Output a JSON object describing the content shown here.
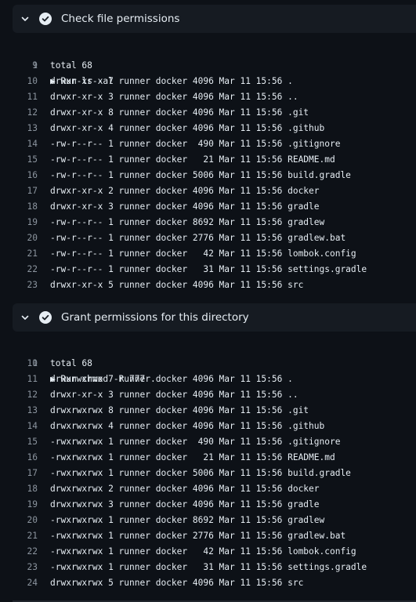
{
  "steps": [
    {
      "title": "Check file permissions",
      "command": "Run ls -al",
      "lines": [
        {
          "n": "1",
          "text": "Run ls -al"
        },
        {
          "n": "9",
          "text": "total 68"
        },
        {
          "n": "10",
          "text": "drwxr-xr-x 7 runner docker 4096 Mar 11 15:56 ."
        },
        {
          "n": "11",
          "text": "drwxr-xr-x 3 runner docker 4096 Mar 11 15:56 .."
        },
        {
          "n": "12",
          "text": "drwxr-xr-x 8 runner docker 4096 Mar 11 15:56 .git"
        },
        {
          "n": "13",
          "text": "drwxr-xr-x 4 runner docker 4096 Mar 11 15:56 .github"
        },
        {
          "n": "14",
          "text": "-rw-r--r-- 1 runner docker  490 Mar 11 15:56 .gitignore"
        },
        {
          "n": "15",
          "text": "-rw-r--r-- 1 runner docker   21 Mar 11 15:56 README.md"
        },
        {
          "n": "16",
          "text": "-rw-r--r-- 1 runner docker 5006 Mar 11 15:56 build.gradle"
        },
        {
          "n": "17",
          "text": "drwxr-xr-x 2 runner docker 4096 Mar 11 15:56 docker"
        },
        {
          "n": "18",
          "text": "drwxr-xr-x 3 runner docker 4096 Mar 11 15:56 gradle"
        },
        {
          "n": "19",
          "text": "-rw-r--r-- 1 runner docker 8692 Mar 11 15:56 gradlew"
        },
        {
          "n": "20",
          "text": "-rw-r--r-- 1 runner docker 2776 Mar 11 15:56 gradlew.bat"
        },
        {
          "n": "21",
          "text": "-rw-r--r-- 1 runner docker   42 Mar 11 15:56 lombok.config"
        },
        {
          "n": "22",
          "text": "-rw-r--r-- 1 runner docker   31 Mar 11 15:56 settings.gradle"
        },
        {
          "n": "23",
          "text": "drwxr-xr-x 5 runner docker 4096 Mar 11 15:56 src"
        }
      ]
    },
    {
      "title": "Grant permissions for this directory",
      "command": "Run chmod -R 777 .",
      "lines": [
        {
          "n": "1",
          "text": "Run chmod -R 777 ."
        },
        {
          "n": "10",
          "text": "total 68"
        },
        {
          "n": "11",
          "text": "drwxrwxrwx 7 runner docker 4096 Mar 11 15:56 ."
        },
        {
          "n": "12",
          "text": "drwxr-xr-x 3 runner docker 4096 Mar 11 15:56 .."
        },
        {
          "n": "13",
          "text": "drwxrwxrwx 8 runner docker 4096 Mar 11 15:56 .git"
        },
        {
          "n": "14",
          "text": "drwxrwxrwx 4 runner docker 4096 Mar 11 15:56 .github"
        },
        {
          "n": "15",
          "text": "-rwxrwxrwx 1 runner docker  490 Mar 11 15:56 .gitignore"
        },
        {
          "n": "16",
          "text": "-rwxrwxrwx 1 runner docker   21 Mar 11 15:56 README.md"
        },
        {
          "n": "17",
          "text": "-rwxrwxrwx 1 runner docker 5006 Mar 11 15:56 build.gradle"
        },
        {
          "n": "18",
          "text": "drwxrwxrwx 2 runner docker 4096 Mar 11 15:56 docker"
        },
        {
          "n": "19",
          "text": "drwxrwxrwx 3 runner docker 4096 Mar 11 15:56 gradle"
        },
        {
          "n": "20",
          "text": "-rwxrwxrwx 1 runner docker 8692 Mar 11 15:56 gradlew"
        },
        {
          "n": "21",
          "text": "-rwxrwxrwx 1 runner docker 2776 Mar 11 15:56 gradlew.bat"
        },
        {
          "n": "22",
          "text": "-rwxrwxrwx 1 runner docker   42 Mar 11 15:56 lombok.config"
        },
        {
          "n": "23",
          "text": "-rwxrwxrwx 1 runner docker   31 Mar 11 15:56 settings.gradle"
        },
        {
          "n": "24",
          "text": "drwxrwxrwx 5 runner docker 4096 Mar 11 15:56 src"
        }
      ]
    }
  ],
  "icons": {
    "expand": "chevron-down-icon",
    "status": "check-circle-icon",
    "toggle": "triangle-right-icon"
  },
  "colors": {
    "background": "#0d1117",
    "header_background": "#161b22",
    "text": "#e6edf3",
    "line_number": "#8b949e"
  }
}
